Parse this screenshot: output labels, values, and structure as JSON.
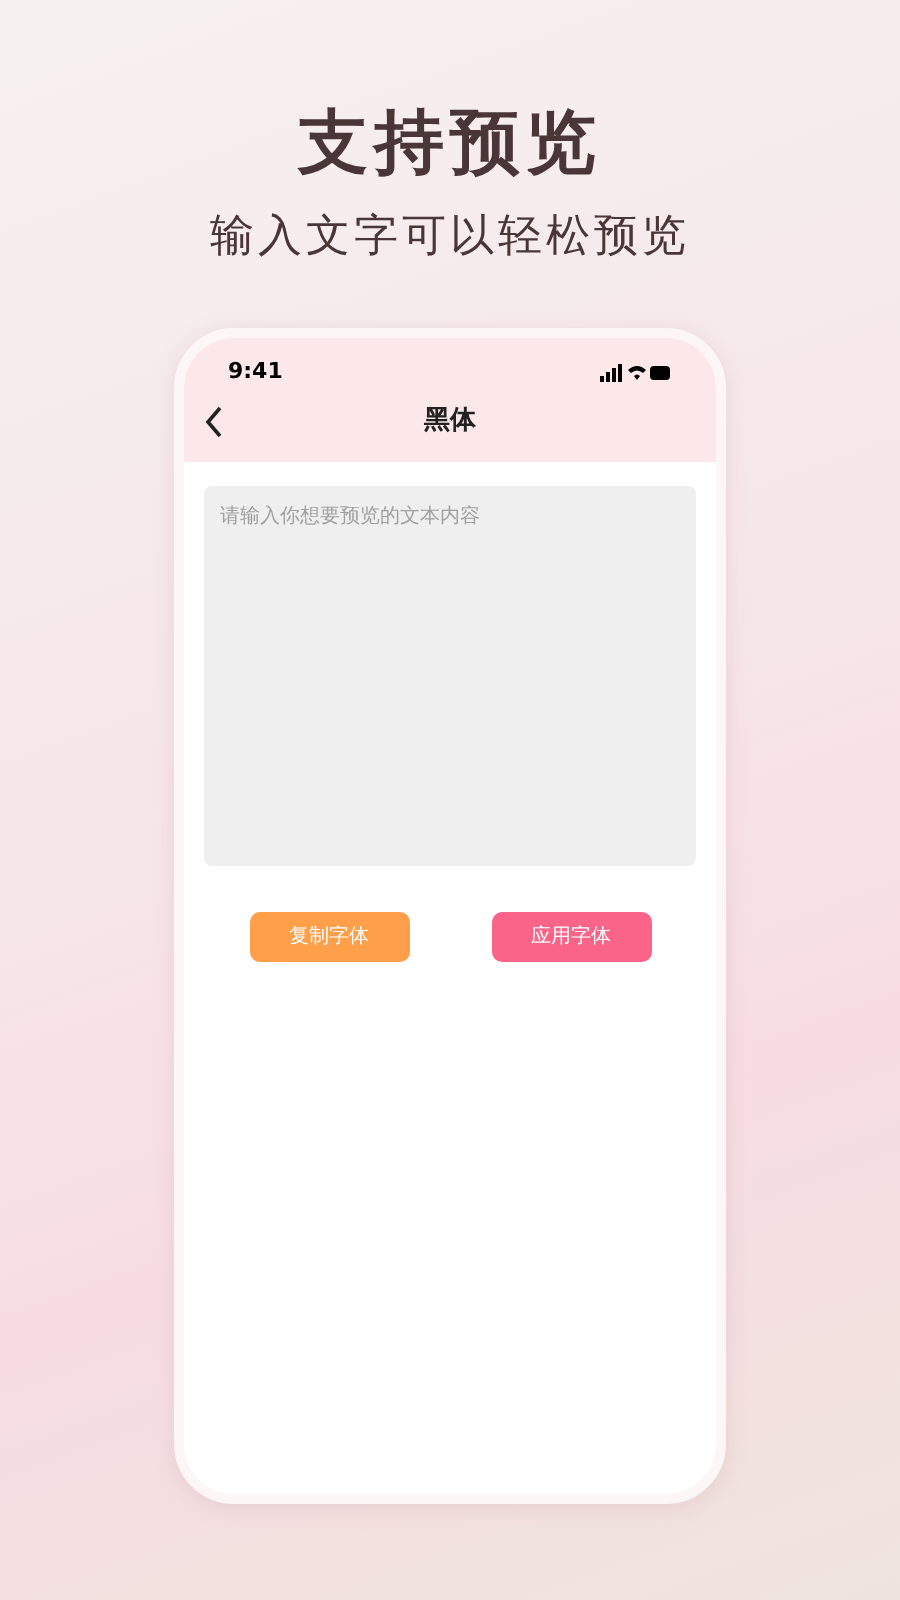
{
  "headline": "支持预览",
  "subheadline": "输入文字可以轻松预览",
  "phone": {
    "status_bar": {
      "time": "9:41"
    },
    "nav": {
      "title": "黑体"
    },
    "text_area": {
      "placeholder": "请输入你想要预览的文本内容"
    },
    "buttons": [
      {
        "label": "复制字体",
        "kind": "copy"
      },
      {
        "label": "应用字体",
        "kind": "apply"
      }
    ]
  }
}
